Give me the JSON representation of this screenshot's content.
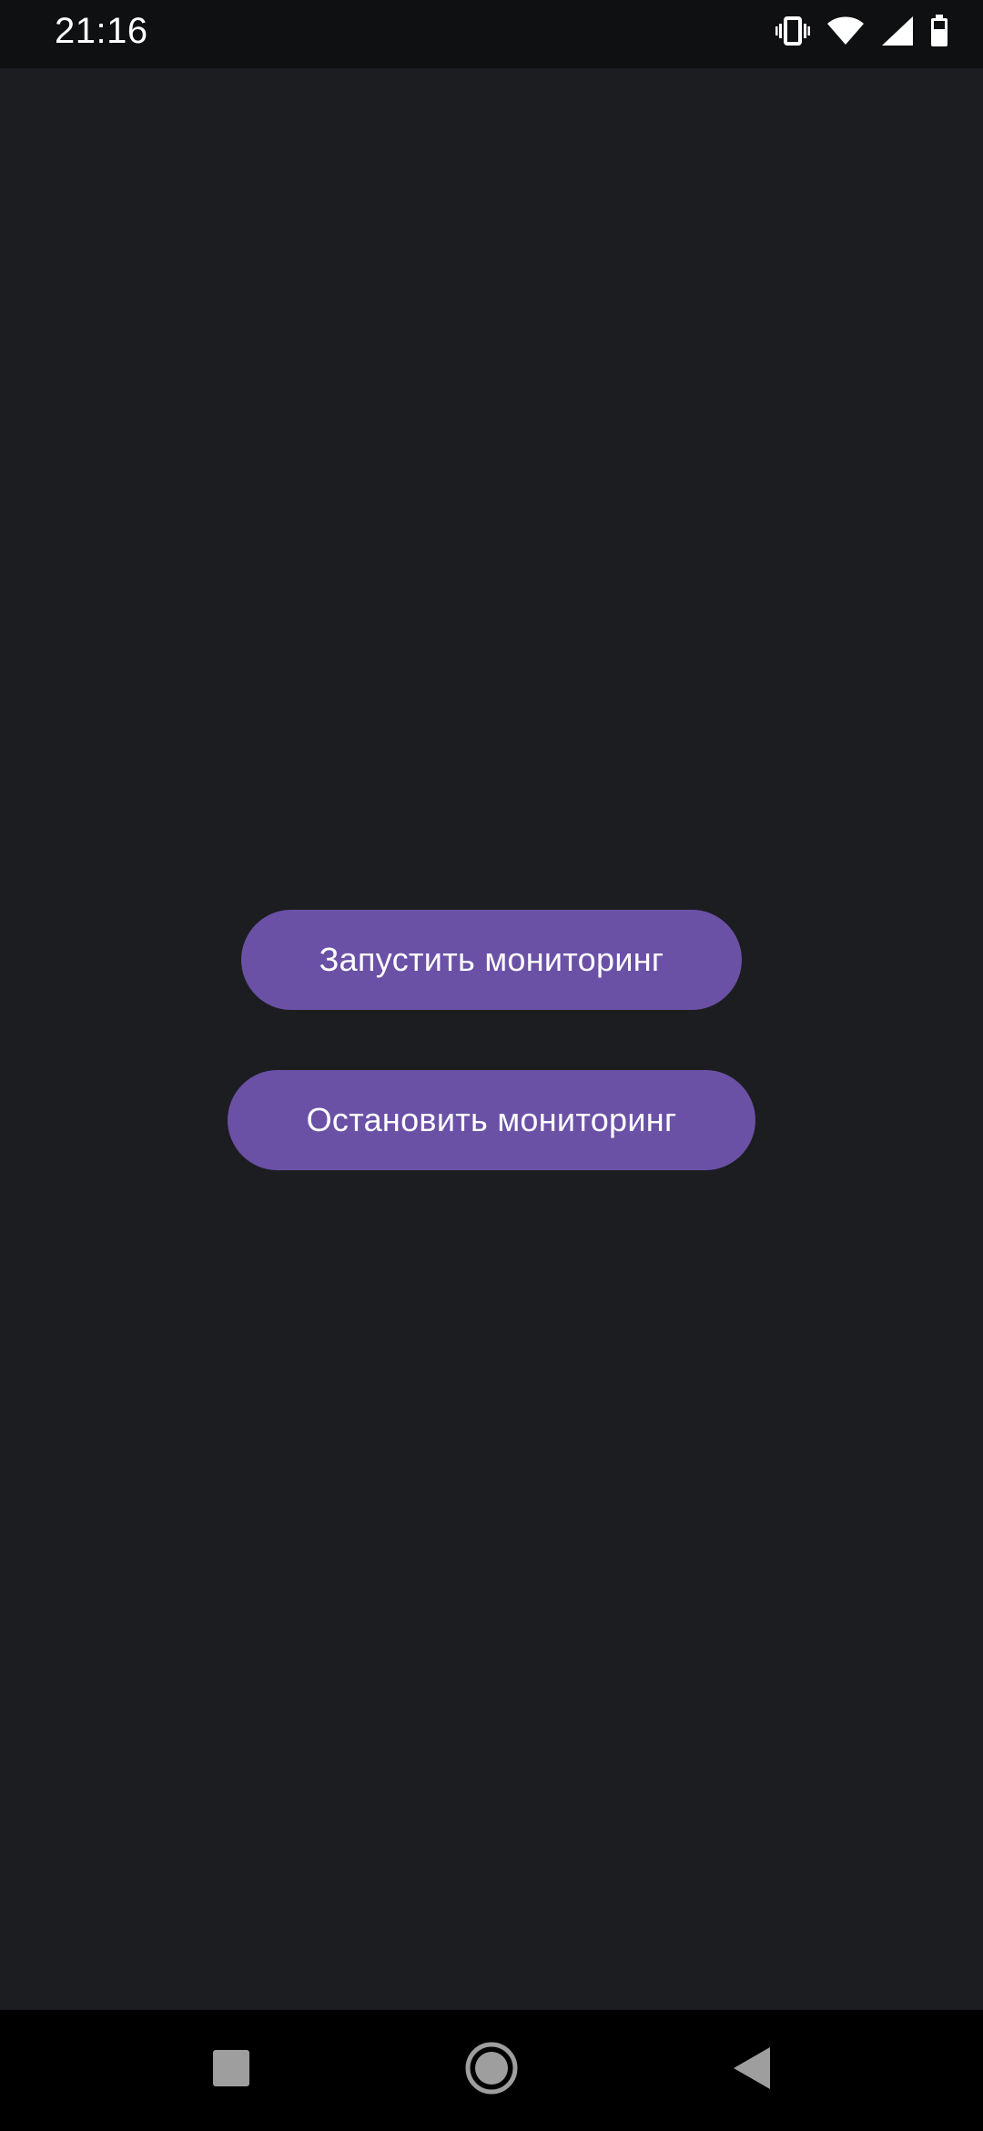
{
  "status_bar": {
    "time": "21:16",
    "icons": [
      "vibrate-icon",
      "wifi-icon",
      "signal-icon",
      "battery-icon"
    ],
    "icon_color": "#ffffff",
    "background": "#0f1012"
  },
  "main": {
    "background": "#1c1d21",
    "buttons": {
      "start_label": "Запустить мониторинг",
      "stop_label": "Остановить мониторинг",
      "color": "#6a51a6",
      "text_color": "#ffffff"
    }
  },
  "nav_bar": {
    "background": "#000000",
    "items": [
      "recent-apps-icon",
      "home-icon",
      "back-icon"
    ],
    "icon_color": "#9e9e9e"
  }
}
